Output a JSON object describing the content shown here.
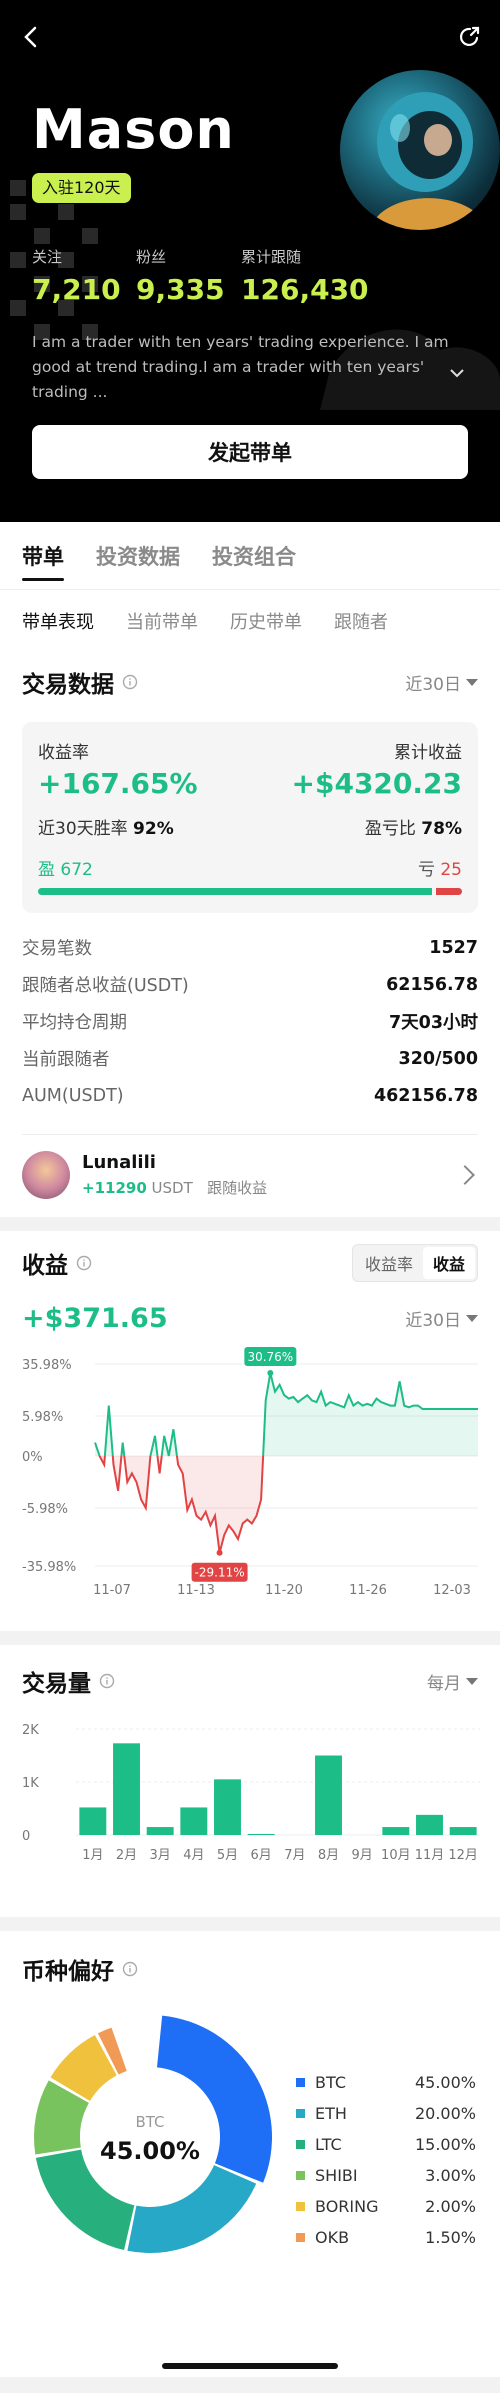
{
  "header": {
    "name": "Mason",
    "join_badge": "入驻120天"
  },
  "stats": [
    {
      "label": "关注",
      "value": "7,210"
    },
    {
      "label": "粉丝",
      "value": "9,335"
    },
    {
      "label": "累计跟随",
      "value": "126,430"
    }
  ],
  "bio": "I am a trader with ten years' trading experience. I am good at trend trading.I am a trader with ten years' trading ...",
  "follow_button": "发起带单",
  "main_tabs": [
    "带单",
    "投资数据",
    "投资组合"
  ],
  "sub_tabs": [
    "带单表现",
    "当前带单",
    "历史带单",
    "跟随者"
  ],
  "trade": {
    "title": "交易数据",
    "period": "近30日",
    "yield_label": "收益率",
    "yield_value": "+167.65%",
    "cum_label": "累计收益",
    "cum_value": "+$4320.23",
    "winrate_label": "近30天胜率",
    "winrate_value": "92%",
    "pl_label": "盈亏比",
    "pl_value": "78%",
    "win_label": "盈",
    "win_count": "672",
    "loss_label": "亏",
    "loss_count": "25",
    "win_fraction": 0.93
  },
  "trade_stats": [
    {
      "k": "交易笔数",
      "v": "1527"
    },
    {
      "k": "跟随者总收益(USDT)",
      "v": "62156.78"
    },
    {
      "k": "平均持仓周期",
      "v": "7天03小时"
    },
    {
      "k": "当前跟随者",
      "v": "320/500"
    },
    {
      "k": "AUM(USDT)",
      "v": "462156.78"
    }
  ],
  "follower": {
    "name": "Lunalili",
    "gain": "+11290",
    "unit": "USDT",
    "note": "跟随收益"
  },
  "profit": {
    "title": "收益",
    "seg": [
      "收益率",
      "收益"
    ],
    "value": "+$371.65",
    "period": "近30日"
  },
  "chart_data": [
    {
      "type": "line",
      "title": "收益",
      "y_ticks": [
        "35.98%",
        "5.98%",
        "0%",
        "-5.98%",
        "-35.98%"
      ],
      "x_ticks": [
        "11-07",
        "11-13",
        "11-20",
        "11-26",
        "12-03"
      ],
      "max_label": "30.76%",
      "min_label": "-29.11%",
      "values": [
        2,
        0,
        -1,
        12,
        -1,
        -4,
        2,
        -3,
        -2,
        -3,
        -5,
        -6,
        0,
        3,
        -2,
        3,
        0,
        4,
        -1,
        -2,
        -7,
        -5,
        -10,
        -12,
        -8,
        -15,
        -10,
        -29.11,
        -20,
        -15,
        -18,
        -22,
        -14,
        -12,
        -14,
        -10,
        -5,
        15,
        30.76,
        20,
        24,
        18,
        16,
        17,
        14,
        16,
        18,
        15,
        14,
        20,
        12,
        14,
        13,
        12,
        11,
        18,
        12,
        14,
        12,
        13,
        12,
        16,
        14,
        13,
        12,
        12,
        26,
        12,
        11,
        12,
        12,
        10,
        10,
        10,
        10,
        10,
        10,
        10,
        10,
        10,
        10,
        10,
        10,
        10
      ]
    },
    {
      "type": "bar",
      "title": "交易量",
      "period": "每月",
      "categories": [
        "1月",
        "2月",
        "3月",
        "4月",
        "5月",
        "6月",
        "7月",
        "8月",
        "9月",
        "10月",
        "11月",
        "12月"
      ],
      "values": [
        520,
        1730,
        150,
        520,
        1050,
        20,
        0,
        1500,
        0,
        150,
        380,
        150
      ],
      "y_ticks": [
        "2K",
        "1K",
        "0"
      ],
      "ylim": [
        0,
        2000
      ],
      "color": "#1dbd88"
    },
    {
      "type": "pie",
      "title": "币种偏好",
      "center_label": "BTC",
      "center_value": "45.00%",
      "categories": [
        "BTC",
        "ETH",
        "LTC",
        "SHIBI",
        "BORING",
        "OKB"
      ],
      "values": [
        45,
        20,
        15,
        3,
        2,
        1.5
      ],
      "labels": [
        "45.00%",
        "20.00%",
        "15.00%",
        "3.00%",
        "2.00%",
        "1.50%"
      ],
      "arc_fractions": [
        0.3,
        0.22,
        0.19,
        0.11,
        0.09,
        0.025
      ],
      "colors": [
        "#1e6ff5",
        "#27a8c7",
        "#27b07e",
        "#79c35f",
        "#f0c13d",
        "#f19a56"
      ]
    }
  ]
}
